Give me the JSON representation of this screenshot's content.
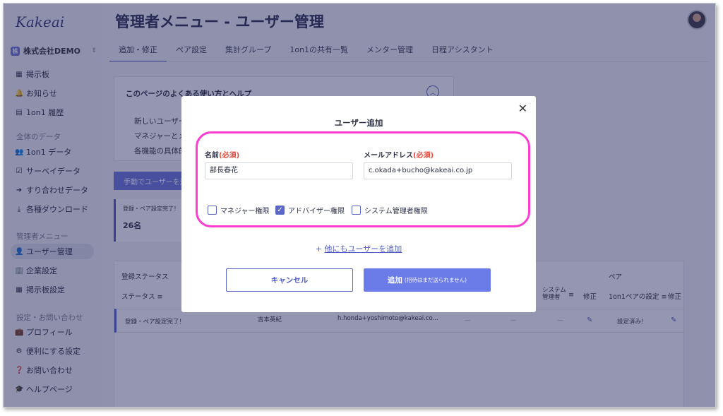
{
  "app": {
    "logo": "Kakeai",
    "company": "株式会社DEMO",
    "company_badge": "株"
  },
  "sidebar": {
    "items": [
      {
        "icon": "▦",
        "label": "掲示板"
      },
      {
        "icon": "🔔",
        "label": "お知らせ"
      },
      {
        "icon": "▤",
        "label": "1on1 履歴"
      }
    ],
    "section_data": "全体のデータ",
    "data_items": [
      {
        "icon": "👥",
        "label": "1on1 データ"
      },
      {
        "icon": "☑",
        "label": "サーベイデータ"
      },
      {
        "icon": "➜",
        "label": "すり合わせデータ"
      },
      {
        "icon": "⤓",
        "label": "各種ダウンロード"
      }
    ],
    "section_admin": "管理者メニュー",
    "admin_items": [
      {
        "icon": "👤",
        "label": "ユーザー管理"
      },
      {
        "icon": "🏢",
        "label": "企業設定"
      },
      {
        "icon": "▦",
        "label": "掲示板設定"
      }
    ],
    "section_settings": "設定・お問い合わせ",
    "settings_items": [
      {
        "icon": "💼",
        "label": "プロフィール"
      },
      {
        "icon": "⚙",
        "label": "便利にする設定"
      },
      {
        "icon": "❓",
        "label": "お問い合わせ"
      },
      {
        "icon": "🎓",
        "label": "ヘルプページ"
      }
    ]
  },
  "main": {
    "title": "管理者メニュー - ユーザー管理",
    "tabs": [
      "追加・修正",
      "ペア設定",
      "集計グループ",
      "1on1の共有一覧",
      "メンター管理",
      "日程アシスタント"
    ],
    "help": {
      "title": "このページのよくある使い方とヘルプ",
      "lines": [
        "新しいユーザーを",
        "マネジャーとメン",
        "各機能の具体的な"
      ]
    },
    "manual_button": "手動でユーザーを追",
    "stat": {
      "label": "登録・ペア設定完了！",
      "value": "26名"
    },
    "table": {
      "group_status": "登録ステータス",
      "col_status": "ステータス",
      "group_pair": "ペア",
      "col_sys": "システム\n管理者",
      "col_edit": "修正",
      "col_pair_setting": "1on1ペアの設定",
      "row": {
        "status": "登録・ペア設定完了！",
        "name": "吉本英紀",
        "email": "h.honda+yoshimoto@kakeai.co...",
        "dash1": "—",
        "dash2": "—",
        "dash3": "—",
        "pair": "設定済み！"
      }
    }
  },
  "modal": {
    "title": "ユーザー追加",
    "name_label": "名前",
    "name_required": "(必須)",
    "name_value": "部長春花",
    "email_label": "メールアドレス",
    "email_required": "(必須)",
    "email_value": "c.okada+bucho@kakeai.co.jp",
    "checkboxes": [
      {
        "label": "マネジャー権限",
        "checked": false
      },
      {
        "label": "アドバイザー権限",
        "checked": true
      },
      {
        "label": "システム管理者権限",
        "checked": false
      }
    ],
    "add_more": "他にもユーザーを追加",
    "add_more_icon": "+",
    "cancel": "キャンセル",
    "submit": "追加",
    "submit_note": "(招待はまだ送られません)"
  },
  "colors": {
    "accent": "#5b66c9",
    "highlight": "#ff3bd1",
    "required": "#e4473a"
  }
}
